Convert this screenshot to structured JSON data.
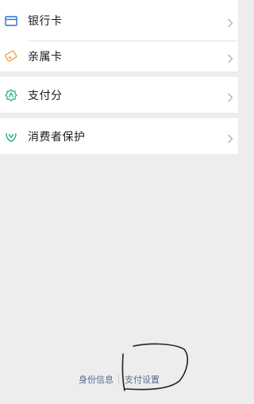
{
  "section1": {
    "items": [
      {
        "label": "银行卡",
        "icon": "bank-card-icon"
      },
      {
        "label": "亲属卡",
        "icon": "family-card-icon"
      }
    ]
  },
  "section2": {
    "items": [
      {
        "label": "支付分",
        "icon": "pay-score-icon"
      }
    ]
  },
  "section3": {
    "items": [
      {
        "label": "消费者保护",
        "icon": "consumer-protection-icon"
      }
    ]
  },
  "footer": {
    "identity_link": "身份信息",
    "payment_settings_link": "支付设置"
  },
  "colors": {
    "background": "#ededed",
    "link": "#576b95",
    "bank_card_icon": "#2f6fd6",
    "family_card_icon": "#f0a23c",
    "pay_score_icon": "#1aad6f",
    "consumer_protection_icon": "#1aad6f"
  }
}
